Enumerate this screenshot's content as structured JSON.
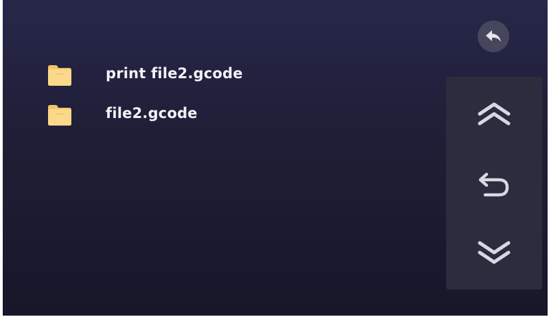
{
  "files": [
    {
      "name": "print file2.gcode",
      "icon": "folder-icon"
    },
    {
      "name": "file2.gcode",
      "icon": "folder-icon"
    }
  ],
  "controls": {
    "back": {
      "icon": "back-arrow-icon"
    },
    "page_up": {
      "icon": "double-chevron-up-icon"
    },
    "return": {
      "icon": "return-arrow-icon"
    },
    "page_down": {
      "icon": "double-chevron-down-icon"
    }
  },
  "colors": {
    "background": "#1e1e36",
    "folder": "#f9d27a",
    "text": "#f2f2f6",
    "icon": "#d8d8e2",
    "panel": "#2c2c3e"
  }
}
